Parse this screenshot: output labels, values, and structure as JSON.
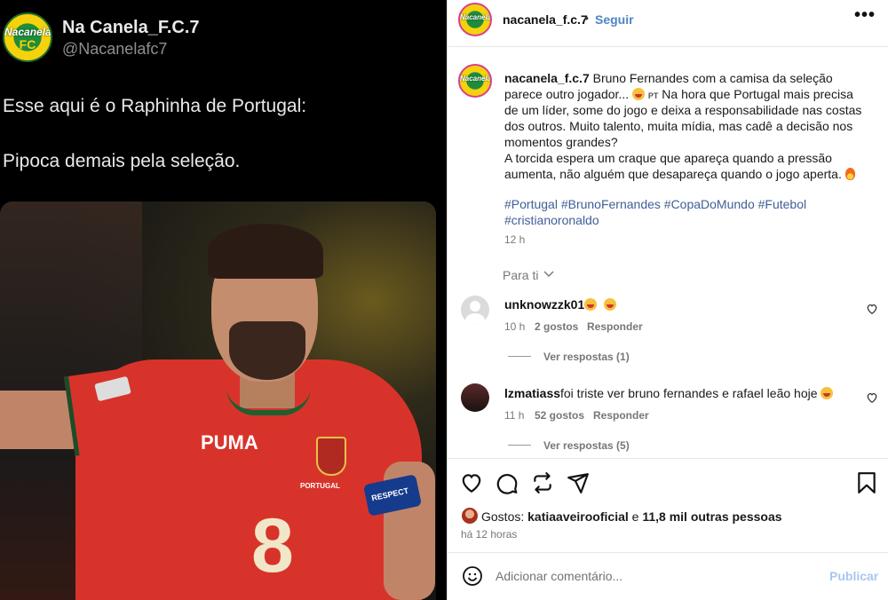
{
  "tweet": {
    "avatar_text": "Nacanela",
    "avatar_fc": "FC",
    "display_name": "Na Canela_F.C.7",
    "handle": "@Nacanelafc7",
    "line1": "Esse aqui é o Raphinha de Portugal:",
    "line2": "Pipoca demais pela seleção.",
    "photo": {
      "jersey_brand": "PUMA",
      "jersey_number": "8",
      "crest_text": "PORTUGAL",
      "armband_text": "RESPECT"
    }
  },
  "post": {
    "avatar_text": "Nacanela",
    "header": {
      "username": "nacanela_f.c.7",
      "separator": "•",
      "follow_label": "Seguir",
      "more_label": "•••"
    },
    "caption": {
      "username": "nacanela_f.c.7",
      "text1": "Bruno Fernandes com a camisa da seleção parece outro jogador... ",
      "badge": "PT",
      "text2": " Na hora que Portugal mais precisa de um líder, some do jogo e deixa a responsabilidade nas costas dos outros. Muito talento, muita mídia, mas cadê a decisão nos momentos grandes?",
      "text3": "A torcida espera um craque que apareça quando a pressão aumenta, não alguém que desapareça quando o jogo aperta. ",
      "hashtags": "#Portugal #BrunoFernandes #CopaDoMundo #Futebol #cristianoronaldo",
      "time": "12 h"
    },
    "sort_label": "Para ti",
    "comments": [
      {
        "username": "unknowzzk01",
        "text": "",
        "time": "10 h",
        "likes": "2 gostos",
        "reply_label": "Responder",
        "view_replies": "Ver respostas (1)"
      },
      {
        "username": "lzmatiass",
        "text": "foi triste ver bruno fernandes e rafael leão hoje",
        "time": "11 h",
        "likes": "52 gostos",
        "reply_label": "Responder",
        "view_replies": "Ver respostas (5)"
      }
    ],
    "likes": {
      "prefix": "Gostos: ",
      "user": "katiaaveirooficial",
      "connector": " e ",
      "others": "11,8 mil outras pessoas"
    },
    "ago": "há 12 horas",
    "add_comment": {
      "placeholder": "Adicionar comentário...",
      "publish_label": "Publicar"
    },
    "icons": [
      "heart-icon",
      "comment-icon",
      "share-icon",
      "send-icon",
      "bookmark-icon",
      "emoji-icon"
    ],
    "colors": {
      "link_blue": "#4d84c6",
      "hashtag": "#3f5f96",
      "publish_disabled": "#a8c7f0",
      "tweet_bg": "#000000"
    }
  }
}
